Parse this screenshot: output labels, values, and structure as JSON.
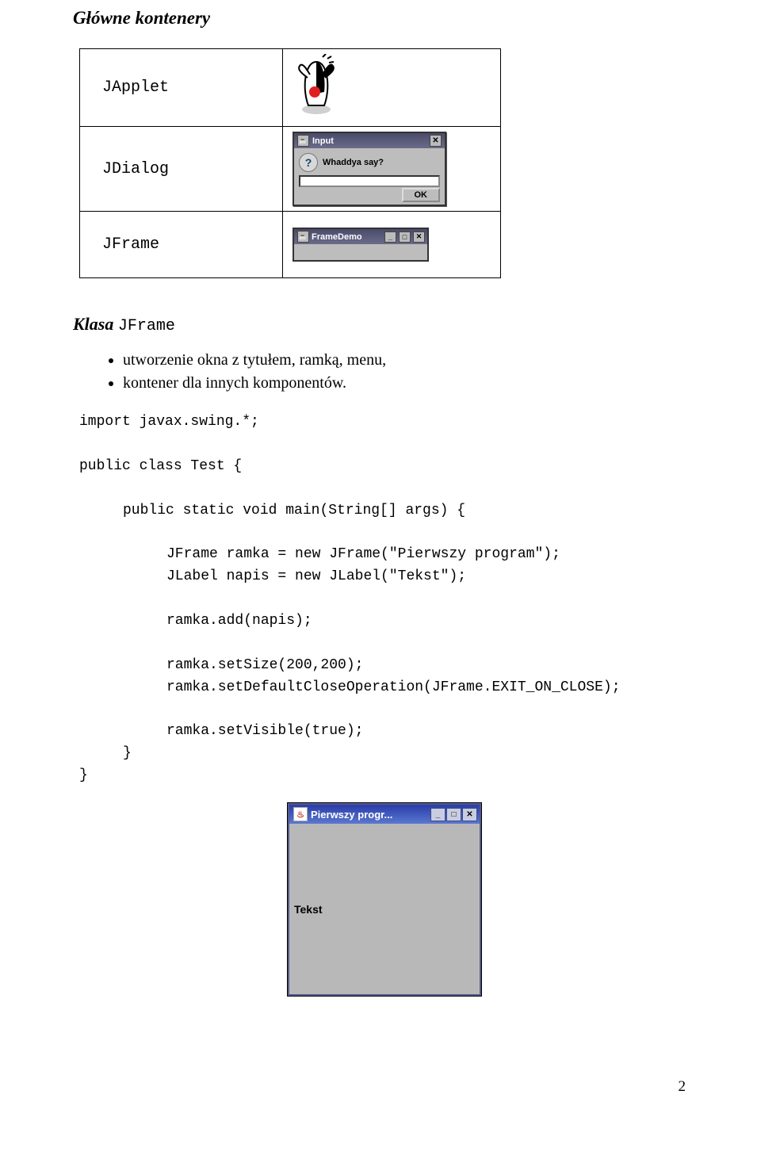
{
  "section_title": "Główne kontenery",
  "table_rows": [
    "JApplet",
    "JDialog",
    "JFrame"
  ],
  "dialog": {
    "title": "Input",
    "prompt": "Whaddya say?",
    "ok": "OK"
  },
  "framedemo": {
    "title": "FrameDemo"
  },
  "subheading": {
    "klasa": "Klasa",
    "classname": "JFrame"
  },
  "bullets": [
    "utworzenie okna z tytułem, ramką, menu,",
    "kontener dla innych komponentów."
  ],
  "code": {
    "l1": "import javax.swing.*;",
    "l2": "public class Test {",
    "l3": "public static void main(String[] args) {",
    "l4": "JFrame ramka = new JFrame(\"Pierwszy program\");",
    "l5": "JLabel napis = new JLabel(\"Tekst\");",
    "l6": "ramka.add(napis);",
    "l7": "ramka.setSize(200,200);",
    "l8": "ramka.setDefaultCloseOperation(JFrame.EXIT_ON_CLOSE);",
    "l9": "ramka.setVisible(true);",
    "l10": "}",
    "l11": "}"
  },
  "program_window": {
    "title": "Pierwszy progr...",
    "label": "Tekst"
  },
  "page_number": "2"
}
